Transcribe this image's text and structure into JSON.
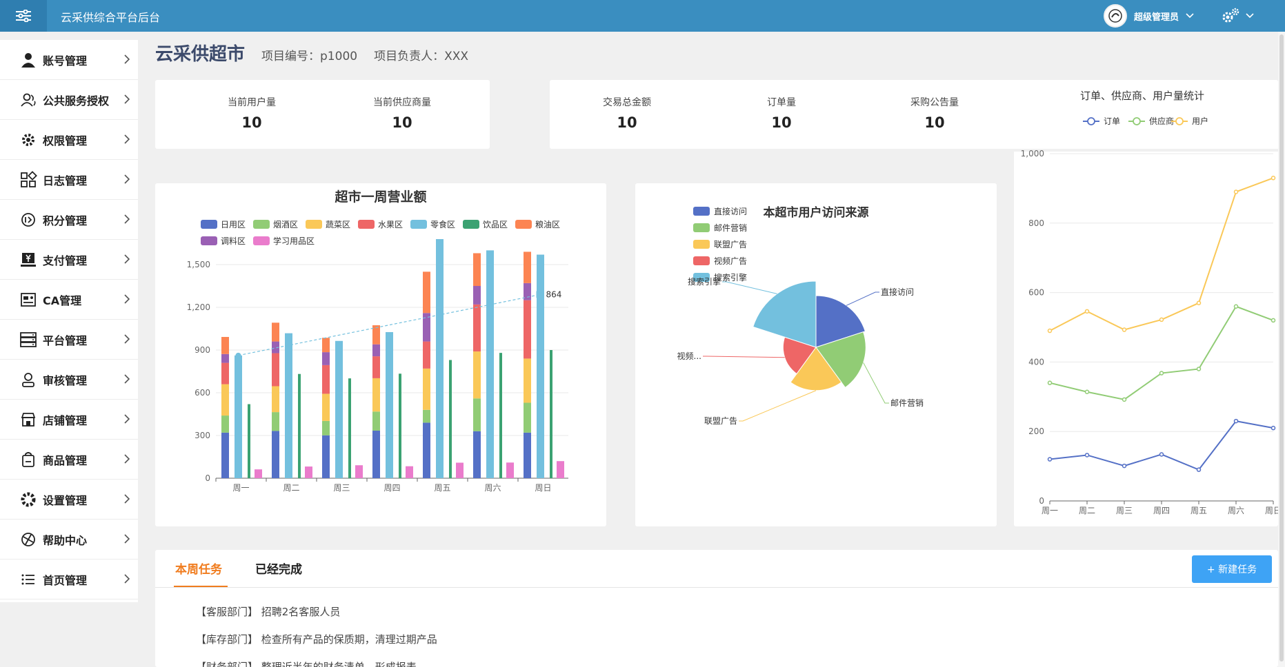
{
  "app": {
    "title": "云采供综合平台后台",
    "user_name": "超级管理员"
  },
  "colors": {
    "header": "#3a8ec0",
    "accent": "#f07c1e",
    "button": "#3ea3f5"
  },
  "sidebar": {
    "items": [
      {
        "label": "账号管理",
        "icon": "user-icon"
      },
      {
        "label": "公共服务授权",
        "icon": "users-icon"
      },
      {
        "label": "权限管理",
        "icon": "gear-icon"
      },
      {
        "label": "日志管理",
        "icon": "grid-icon"
      },
      {
        "label": "积分管理",
        "icon": "points-icon"
      },
      {
        "label": "支付管理",
        "icon": "payment-icon"
      },
      {
        "label": "CA管理",
        "icon": "certificate-icon"
      },
      {
        "label": "平台管理",
        "icon": "server-icon"
      },
      {
        "label": "审核管理",
        "icon": "review-icon"
      },
      {
        "label": "店铺管理",
        "icon": "store-icon"
      },
      {
        "label": "商品管理",
        "icon": "goods-icon"
      },
      {
        "label": "设置管理",
        "icon": "settings-icon"
      },
      {
        "label": "帮助中心",
        "icon": "help-icon"
      },
      {
        "label": "首页管理",
        "icon": "list-icon"
      }
    ]
  },
  "page": {
    "title": "云采供超市",
    "project_no": "项目编号：p1000",
    "project_owner": "项目负责人：XXX"
  },
  "stats": {
    "users": {
      "label": "当前用户量",
      "value": "10"
    },
    "suppliers": {
      "label": "当前供应商量",
      "value": "10"
    },
    "amount": {
      "label": "交易总金额",
      "value": "10"
    },
    "orders": {
      "label": "订单量",
      "value": "10"
    },
    "notices": {
      "label": "采购公告量",
      "value": "10"
    }
  },
  "chart_data": [
    {
      "type": "bar",
      "title": "超市一周营业额",
      "categories": [
        "周一",
        "周二",
        "周三",
        "周四",
        "周五",
        "周六",
        "周日"
      ],
      "ylim": [
        0,
        1500
      ],
      "yticks": [
        "0",
        "300",
        "600",
        "900",
        "1,200",
        "1,500"
      ],
      "stack_series": [
        {
          "name": "日用区",
          "color": "#5470c6",
          "values": [
            320,
            332,
            301,
            334,
            390,
            330,
            320
          ]
        },
        {
          "name": "烟酒区",
          "color": "#91cc75",
          "values": [
            120,
            132,
            101,
            134,
            90,
            230,
            210
          ]
        },
        {
          "name": "蔬菜区",
          "color": "#fac858",
          "values": [
            220,
            182,
            191,
            234,
            290,
            330,
            310
          ]
        },
        {
          "name": "水果区",
          "color": "#ee6666",
          "values": [
            150,
            232,
            201,
            154,
            190,
            330,
            410
          ]
        },
        {
          "name": "调料区",
          "color": "#9a60b4",
          "values": [
            62,
            82,
            91,
            84,
            200,
            130,
            120
          ]
        },
        {
          "name": "粮油区",
          "color": "#fc8452",
          "values": [
            120,
            132,
            101,
            134,
            290,
            230,
            220
          ]
        }
      ],
      "other_series": [
        {
          "name": "零食区",
          "color": "#73c0de",
          "values": [
            862,
            1018,
            964,
            1026,
            1679,
            1600,
            1570
          ]
        },
        {
          "name": "饮品区",
          "color": "#3ba272",
          "values": [
            520,
            732,
            701,
            734,
            830,
            880,
            900
          ]
        },
        {
          "name": "学习用品区",
          "color": "#ea7ccc",
          "values": [
            62,
            82,
            91,
            84,
            109,
            110,
            120
          ]
        }
      ],
      "legend_order": [
        "日用区",
        "烟酒区",
        "蔬菜区",
        "水果区",
        "零食区",
        "饮品区",
        "粮油区",
        "调料区",
        "学习用品区"
      ],
      "markline_label": "864",
      "markline_values": [
        862,
        1290
      ]
    },
    {
      "type": "pie",
      "title": "本超市用户访问来源",
      "slices": [
        {
          "name": "直接访问",
          "value": 335,
          "label": "直接访问",
          "color": "#5470c6"
        },
        {
          "name": "邮件营销",
          "value": 310,
          "label": "邮件营销",
          "color": "#91cc75"
        },
        {
          "name": "联盟广告",
          "value": 234,
          "label": "联盟广告",
          "color": "#fac858"
        },
        {
          "name": "视频广告",
          "value": 135,
          "label": "视频...",
          "color": "#ee6666"
        },
        {
          "name": "搜索引擎",
          "value": 548,
          "label": "搜索引擎",
          "color": "#73c0de"
        }
      ]
    },
    {
      "type": "line",
      "title": "订单、供应商、用户量统计",
      "categories": [
        "周一",
        "周二",
        "周三",
        "周四",
        "周五",
        "周六",
        "周日"
      ],
      "ylim": [
        0,
        1000
      ],
      "yticks": [
        "0",
        "200",
        "400",
        "600",
        "800",
        "1,000"
      ],
      "series": [
        {
          "name": "订单",
          "color": "#5470c6",
          "values": [
            120,
            132,
            101,
            134,
            90,
            230,
            210
          ]
        },
        {
          "name": "供应商",
          "color": "#91cc75",
          "values": [
            340,
            314,
            292,
            368,
            380,
            560,
            520
          ]
        },
        {
          "name": "用户",
          "color": "#fac858",
          "values": [
            490,
            546,
            493,
            522,
            570,
            890,
            930
          ]
        }
      ]
    }
  ],
  "tasks": {
    "tab_current": "本周任务",
    "tab_done": "已经完成",
    "new_button": "+ 新建任务",
    "items": [
      "【客服部门】 招聘2名客服人员",
      "【库存部门】 检查所有产品的保质期，清理过期产品",
      "【财务部门】 整理近半年的财务清单，形成报表"
    ]
  }
}
